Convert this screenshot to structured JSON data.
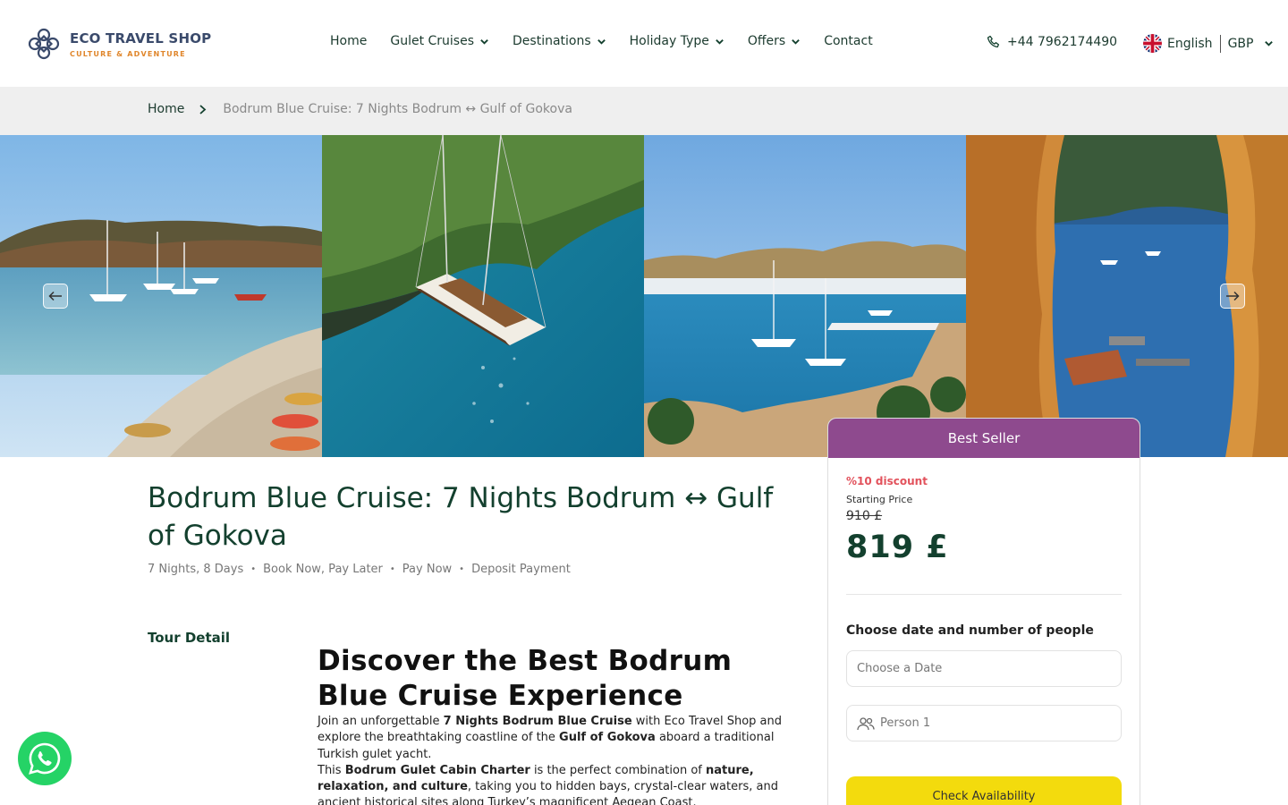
{
  "brand": {
    "name": "ECO TRAVEL SHOP",
    "tagline": "CULTURE & ADVENTURE"
  },
  "nav": {
    "items": [
      {
        "label": "Home",
        "has_dropdown": false
      },
      {
        "label": "Gulet Cruises",
        "has_dropdown": true
      },
      {
        "label": "Destinations",
        "has_dropdown": true
      },
      {
        "label": "Holiday Type",
        "has_dropdown": true
      },
      {
        "label": "Offers",
        "has_dropdown": true
      },
      {
        "label": "Contact",
        "has_dropdown": false
      }
    ],
    "phone": "+44 7962174490",
    "language": "English",
    "currency": "GBP"
  },
  "breadcrumb": {
    "home": "Home",
    "current": "Bodrum Blue Cruise: 7 Nights Bodrum ↔ Gulf of Gokova"
  },
  "gallery": {
    "photos": [
      {
        "icon": "beach-bay-photo"
      },
      {
        "icon": "gulet-yacht-photo"
      },
      {
        "icon": "harbor-castle-photo"
      },
      {
        "icon": "rock-window-bay-photo"
      }
    ]
  },
  "tour": {
    "title": "Bodrum Blue Cruise: 7 Nights Bodrum ↔ Gulf of Gokova",
    "meta": [
      "7 Nights, 8 Days",
      "Book Now, Pay Later",
      "Pay Now",
      "Deposit Payment"
    ],
    "detail_label": "Tour Detail",
    "heading": "Discover the Best Bodrum Blue Cruise Experience",
    "p1": {
      "a": "Join an unforgettable ",
      "b": "7 Nights Bodrum Blue Cruise",
      "c": " with Eco Travel Shop and explore the breathtaking coastline of the ",
      "d": "Gulf of Gokova",
      "e": " aboard a traditional Turkish gulet yacht."
    },
    "p2": {
      "a": "This ",
      "b": "Bodrum Gulet Cabin Charter",
      "c": " is the perfect combination of ",
      "d": "nature, relaxation, and culture",
      "e": ", taking you to hidden bays, crystal-clear waters, and ancient historical sites along Turkey’s magnificent Aegean Coast."
    }
  },
  "booking": {
    "badge": "Best Seller",
    "discount": "%10 discount",
    "starting_label": "Starting Price",
    "old_price": "910 £",
    "new_price": "819 £",
    "choose_label": "Choose date and number of people",
    "date_placeholder": "Choose a Date",
    "person_value": "Person 1",
    "button_label": "Check Availability"
  },
  "colors": {
    "primary": "#13402e",
    "badge": "#8e4a8e",
    "discount": "#e2525c",
    "cta": "#f3db0d",
    "whatsapp": "#25d366"
  }
}
